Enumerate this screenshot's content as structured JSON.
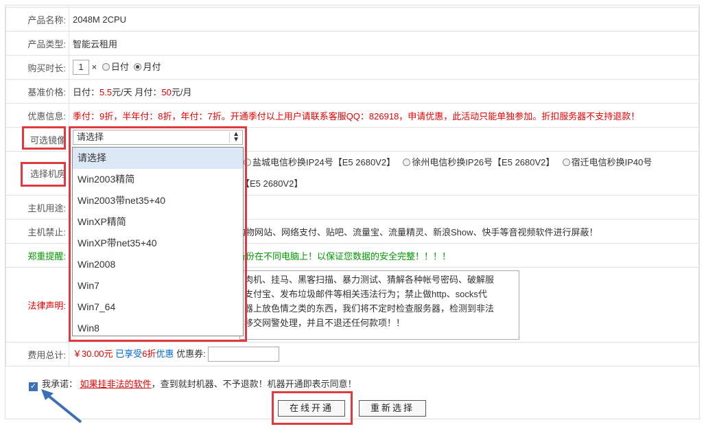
{
  "labels": {
    "product_name": "产品名称:",
    "product_type": "产品类型:",
    "duration": "购买时长:",
    "base_price": "基准价格:",
    "discount": "优惠信息:",
    "image": "可选镜像",
    "datacenter": "选择机房",
    "usage": "主机用途:",
    "forbidden": "主机禁止:",
    "notice": "郑重提醒:",
    "legal": "法律声明:",
    "total": "费用总计:"
  },
  "values": {
    "product_name": "2048M 2CPU",
    "product_type": "智能云租用",
    "duration_qty": "1",
    "duration_times": "×",
    "duration_daily": "日付",
    "duration_monthly": "月付",
    "price_daily_label": "日付：",
    "price_daily": "5.5",
    "price_daily_unit": "元/天",
    "price_monthly_label": "月付：",
    "price_monthly": "50",
    "price_monthly_unit": "元/月",
    "discount_text": "季付：9折，半年付：8折，年付：7折。开通季付以上用户请联系客服QQ：826918，申请优惠，此活动只能单独参加。折扣服务器不支持退款！",
    "datacenter_line1_a": "盐城电信秒换IP24号【E5 2680V2】",
    "datacenter_line1_b": "徐州电信秒换IP26号【E5 2680V2】",
    "datacenter_line1_c": "宿迁电信秒换IP40号",
    "datacenter_line2": "【E5 2680V2】",
    "forbidden_text": "购物网站、网络支付、贴吧、流量宝、流量精灵、新浪Show、快手等音视频软件进行屏蔽！",
    "notice_text": "备份在不同电脑上！以保证您数据的安全完整！！！！",
    "legal_text": "肉机、挂马、黑客扫描、暴力测试、猜解各种帐号密码、破解服\n支付宝、发布垃圾邮件等相关违法行为；禁止做http、socks代\n器上放色情之类的东西，我们将不定时检查服务器，检测到非法\n移交网警处理，并且不退还任何款项！！",
    "total_price": "￥30.00元",
    "total_discount_prefix": "已享受",
    "total_discount_value": "6折",
    "total_discount_suffix": "优惠",
    "coupon_label": "优惠券:"
  },
  "image_select": {
    "selected": "请选择",
    "options": [
      "请选择",
      "Win2003精简",
      "Win2003带net35+40",
      "WinXP精简",
      "WinXP带net35+40",
      "Win2008",
      "Win7",
      "Win7_64",
      "Win8"
    ]
  },
  "promise": {
    "prefix": "我承诺：",
    "link": "如果挂非法的软件",
    "suffix": "，查到就封机器、不予退款！机器开通即表示同意！",
    "checked": true
  },
  "buttons": {
    "open": "在线开通",
    "reset": "重新选择"
  },
  "colors": {
    "highlight": "#e0393e",
    "accent_red": "#e60000",
    "notice_green": "#009900",
    "discount_blue": "#0066cc",
    "annotation_arrow": "#3b6fb6"
  }
}
